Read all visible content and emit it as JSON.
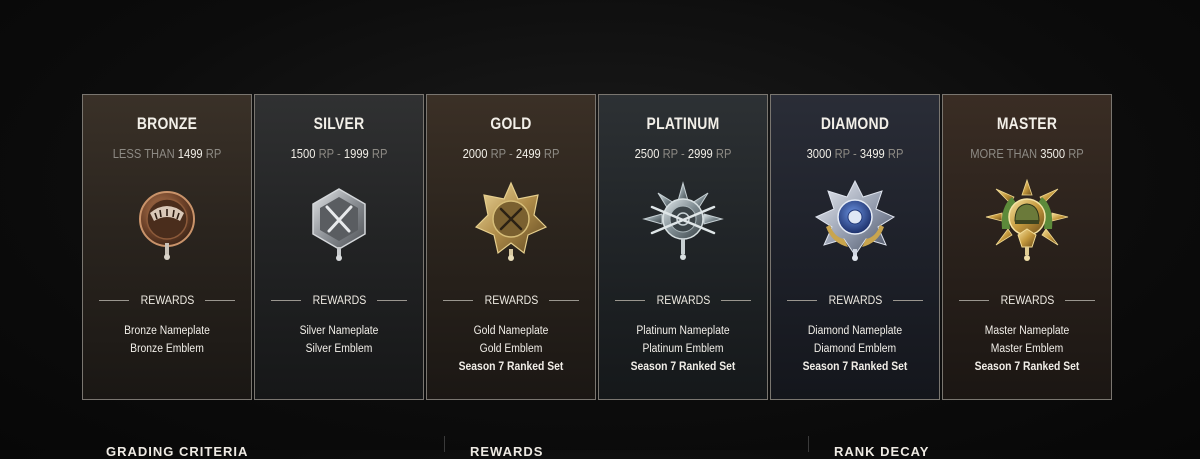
{
  "tiers": [
    {
      "name": "BRONZE",
      "range_prefix": "LESS THAN",
      "range_value": "1499",
      "range_unit": "RP",
      "rewards_label": "REWARDS",
      "rewards": [
        "Bronze Nameplate",
        "Bronze Emblem"
      ],
      "badge_icon": "bronze-rank-badge-icon",
      "color": "#8a5a3a"
    },
    {
      "name": "SILVER",
      "range_low": "1500",
      "range_high": "1999",
      "range_unit": "RP",
      "rewards_label": "REWARDS",
      "rewards": [
        "Silver Nameplate",
        "Silver Emblem"
      ],
      "badge_icon": "silver-rank-badge-icon",
      "color": "#b4b8bc"
    },
    {
      "name": "GOLD",
      "range_low": "2000",
      "range_high": "2499",
      "range_unit": "RP",
      "rewards_label": "REWARDS",
      "rewards": [
        "Gold Nameplate",
        "Gold Emblem"
      ],
      "season_reward": "Season 7 Ranked Set",
      "badge_icon": "gold-rank-badge-icon",
      "color": "#c9a85a"
    },
    {
      "name": "PLATINUM",
      "range_low": "2500",
      "range_high": "2999",
      "range_unit": "RP",
      "rewards_label": "REWARDS",
      "rewards": [
        "Platinum Nameplate",
        "Platinum Emblem"
      ],
      "season_reward": "Season 7 Ranked Set",
      "badge_icon": "platinum-rank-badge-icon",
      "color": "#9aa6ab"
    },
    {
      "name": "DIAMOND",
      "range_low": "3000",
      "range_high": "3499",
      "range_unit": "RP",
      "rewards_label": "REWARDS",
      "rewards": [
        "Diamond Nameplate",
        "Diamond Emblem"
      ],
      "season_reward": "Season 7 Ranked Set",
      "badge_icon": "diamond-rank-badge-icon",
      "color": "#3f66b8"
    },
    {
      "name": "MASTER",
      "range_prefix": "MORE THAN",
      "range_value": "3500",
      "range_unit": "RP",
      "rewards_label": "REWARDS",
      "rewards": [
        "Master Nameplate",
        "Master Emblem"
      ],
      "season_reward": "Season 7 Ranked Set",
      "badge_icon": "master-rank-badge-icon",
      "color": "#d9b35a"
    }
  ],
  "range_separator": "-",
  "bottom_sections": {
    "grading_criteria": "GRADING CRITERIA",
    "rewards": "REWARDS",
    "rank_decay": "RANK DECAY"
  }
}
